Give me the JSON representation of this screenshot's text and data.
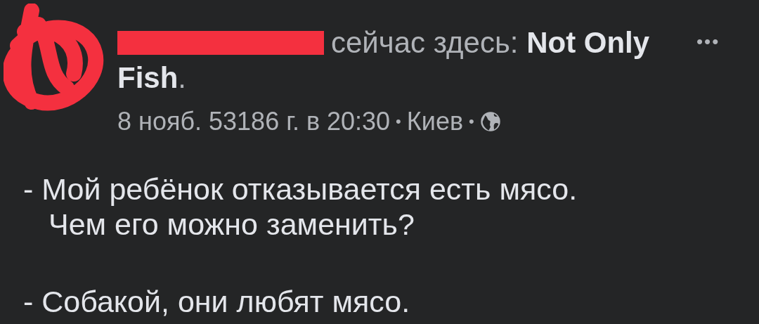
{
  "post": {
    "headline": [
      "сейчас здесь: **Not Only**",
      "**Fish**."
    ],
    "meta": {
      "date": "8 нояб. 53186 г. в 20:30",
      "separator": "•",
      "place": "Киев"
    },
    "more": "•••",
    "lines": [
      {
        "text": "- Мой ребёнок отказывается есть мясо.",
        "kind": "start"
      },
      {
        "text": "Чем его можно заменить?",
        "kind": "indented"
      },
      {
        "text": "- Собакой, они любят мясо.",
        "kind": "gap"
      }
    ]
  }
}
